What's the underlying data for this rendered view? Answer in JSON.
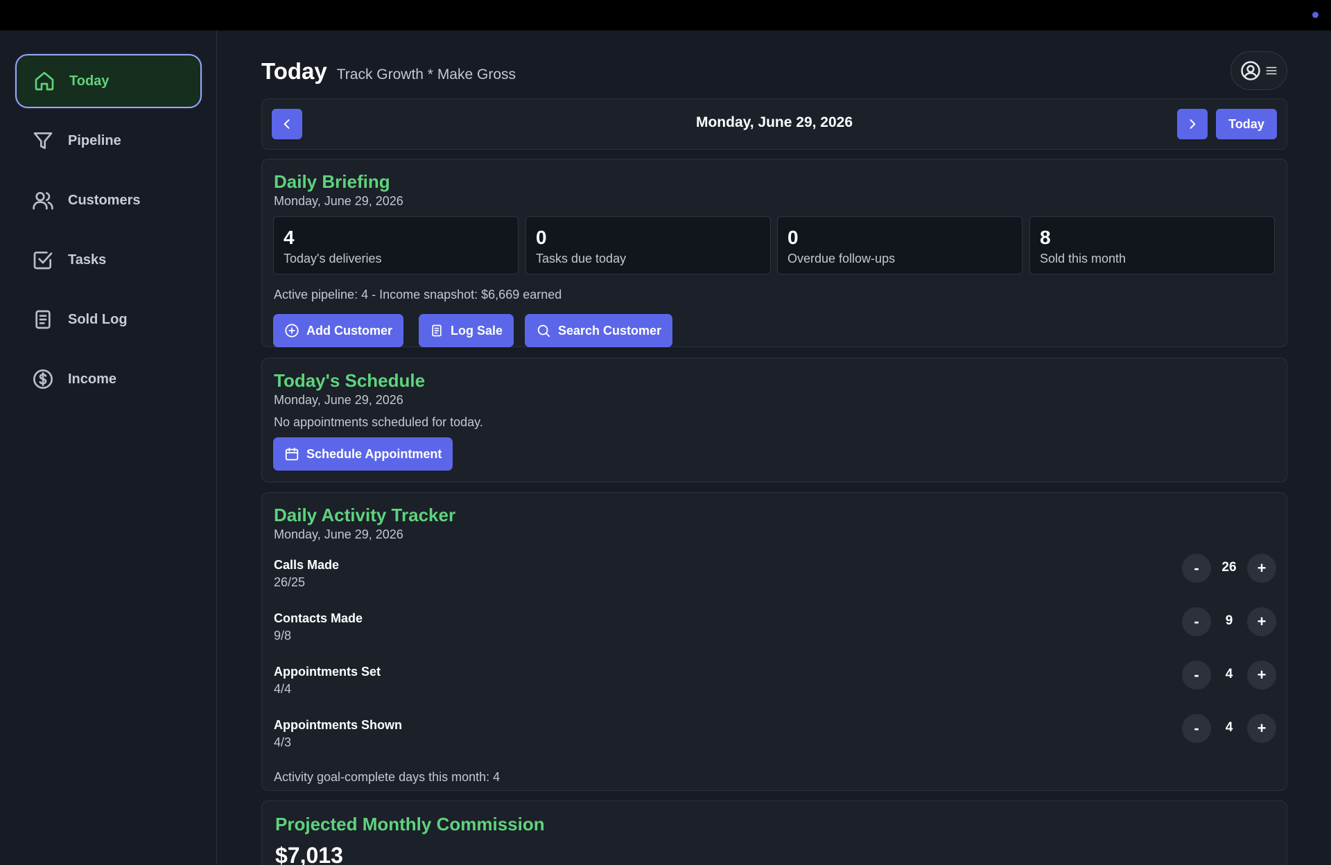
{
  "colors": {
    "accent": "#5b67e8",
    "green": "#5fd37c",
    "background": "#161b24"
  },
  "sidebar": {
    "items": [
      {
        "label": "Today",
        "icon": "home-icon",
        "active": true
      },
      {
        "label": "Pipeline",
        "icon": "funnel-icon"
      },
      {
        "label": "Customers",
        "icon": "users-icon"
      },
      {
        "label": "Tasks",
        "icon": "checkbox-icon"
      },
      {
        "label": "Sold Log",
        "icon": "document-icon"
      },
      {
        "label": "Income",
        "icon": "dollar-circle-icon"
      }
    ]
  },
  "header": {
    "title": "Today",
    "subtitle": "Track Growth * Make Gross"
  },
  "date_nav": {
    "date": "Monday, June 29, 2026",
    "today_label": "Today"
  },
  "briefing": {
    "title": "Daily Briefing",
    "date": "Monday, June 29, 2026",
    "stats": [
      {
        "value": "4",
        "label": "Today's deliveries"
      },
      {
        "value": "0",
        "label": "Tasks due today"
      },
      {
        "value": "0",
        "label": "Overdue follow-ups"
      },
      {
        "value": "8",
        "label": "Sold this month"
      }
    ],
    "summary": "Active pipeline: 4 - Income snapshot: $6,669 earned",
    "actions": {
      "add_customer": "Add Customer",
      "log_sale": "Log Sale",
      "search_customer": "Search Customer"
    }
  },
  "schedule": {
    "title": "Today's Schedule",
    "date": "Monday, June 29, 2026",
    "empty_text": "No appointments scheduled for today.",
    "button": "Schedule Appointment"
  },
  "activity": {
    "title": "Daily Activity Tracker",
    "date": "Monday, June 29, 2026",
    "rows": [
      {
        "label": "Calls Made",
        "progress": "26/25",
        "value": "26"
      },
      {
        "label": "Contacts Made",
        "progress": "9/8",
        "value": "9"
      },
      {
        "label": "Appointments Set",
        "progress": "4/4",
        "value": "4"
      },
      {
        "label": "Appointments Shown",
        "progress": "4/3",
        "value": "4"
      }
    ],
    "minus_label": "-",
    "plus_label": "+",
    "footer": "Activity goal-complete days this month: 4"
  },
  "commission": {
    "title": "Projected Monthly Commission",
    "amount": "$7,013"
  }
}
